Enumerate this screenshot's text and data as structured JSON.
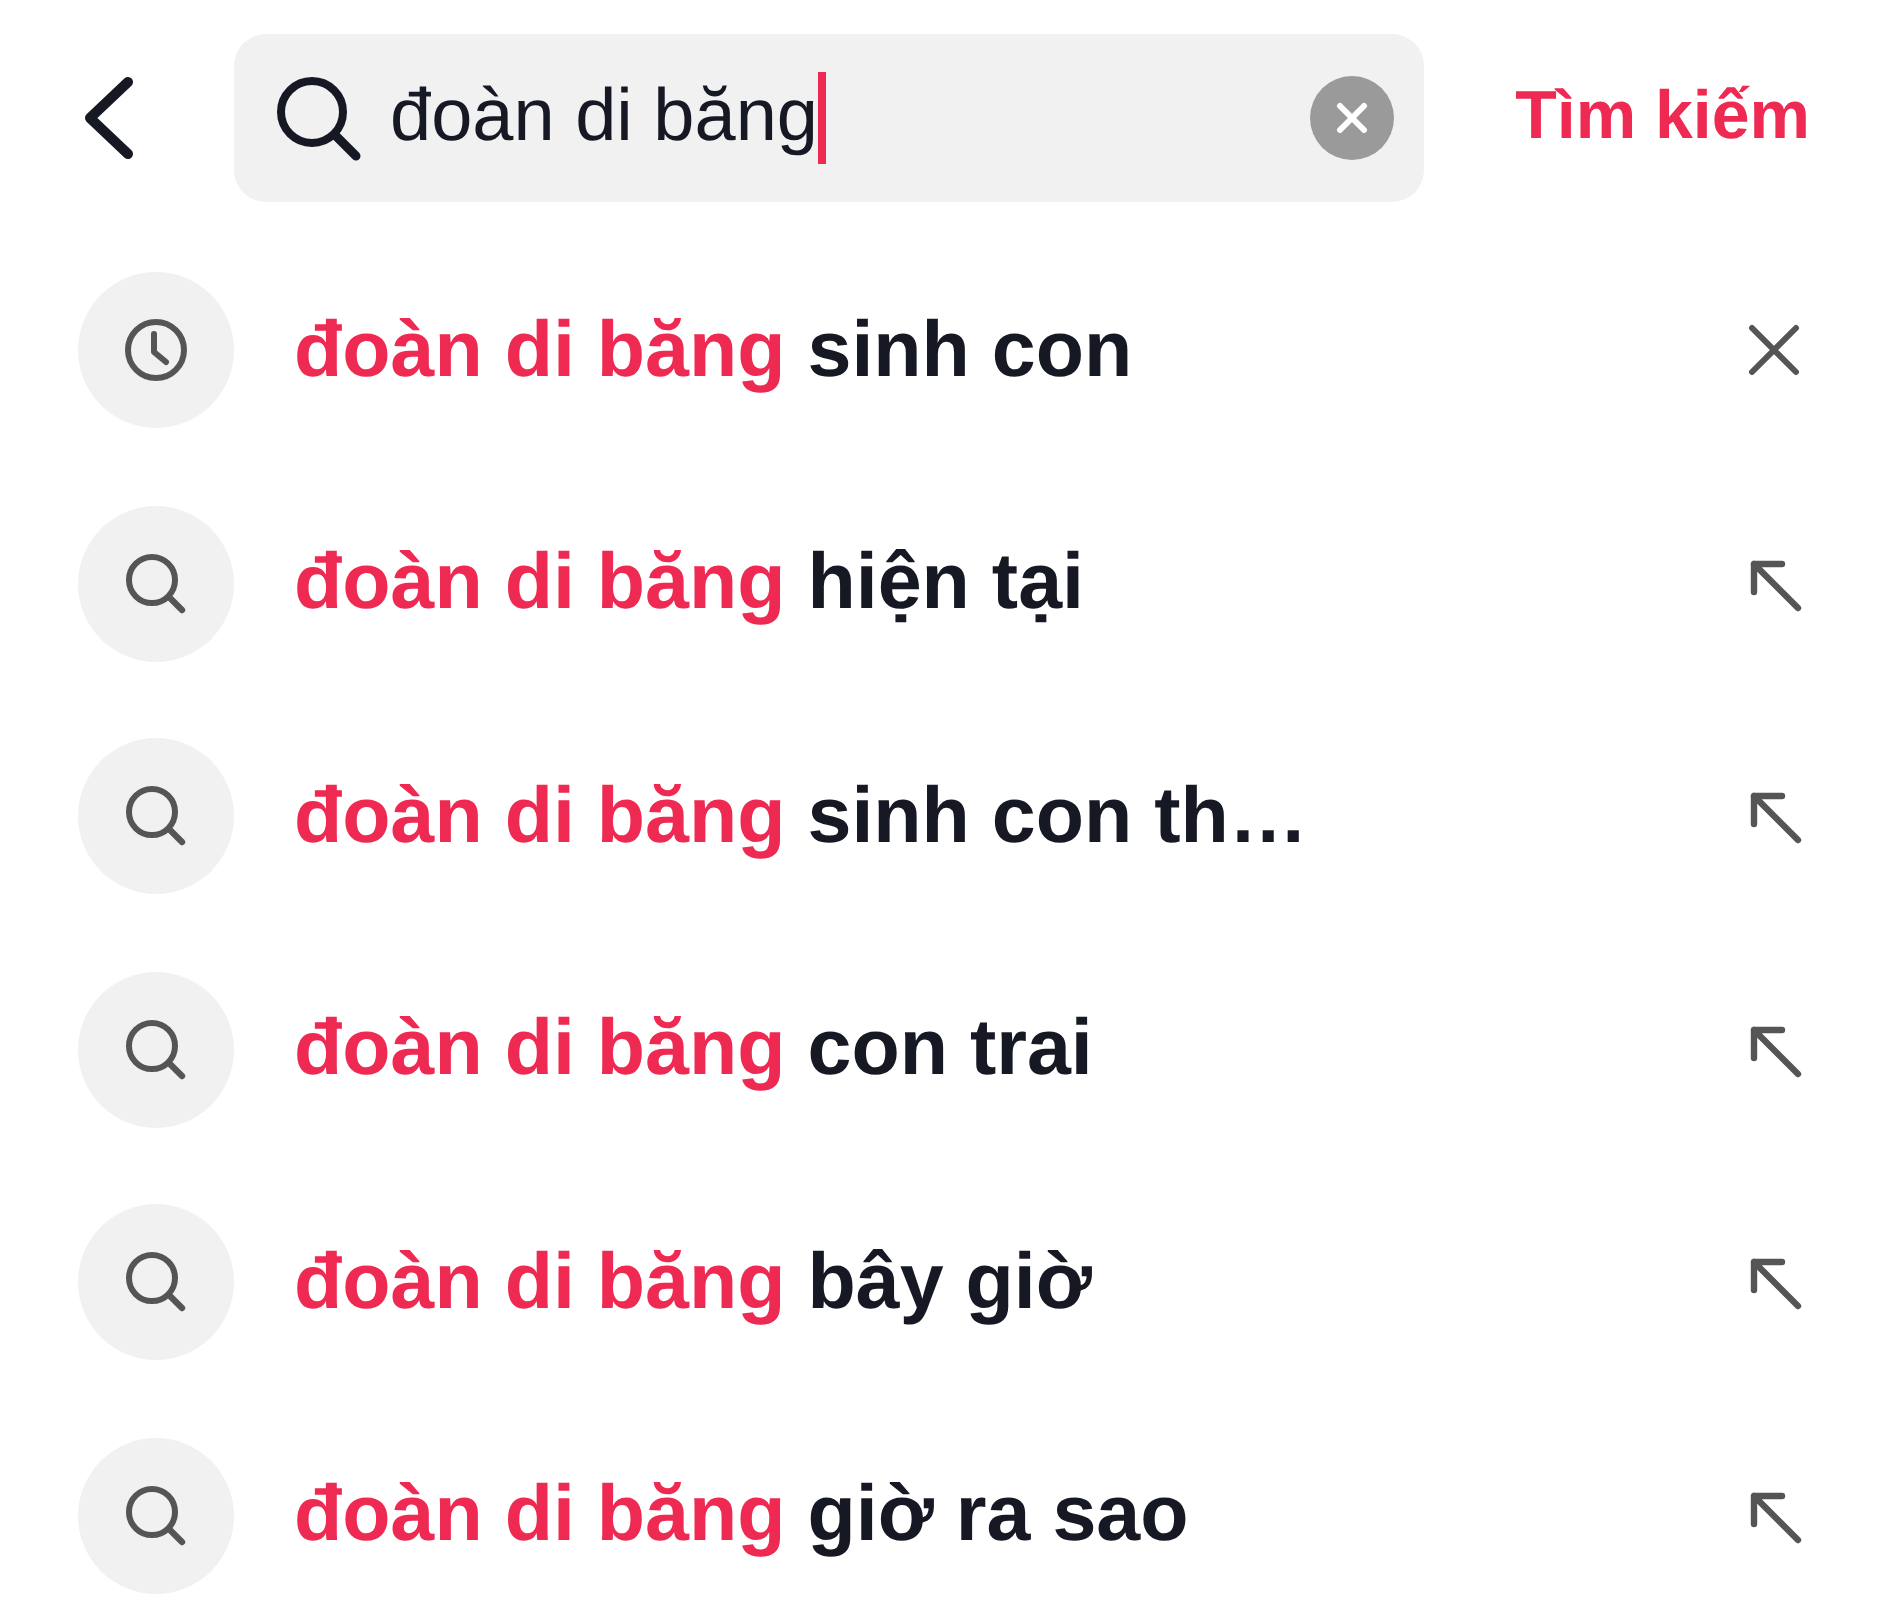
{
  "search_bar": {
    "query": "đoàn di băng",
    "submit": "Tìm kiếm"
  },
  "suggestions": [
    {
      "kind": "history",
      "match": "đoàn di băng",
      "rest": "sinh con"
    },
    {
      "kind": "suggestion",
      "match": "đoàn di băng",
      "rest": "hiện tại"
    },
    {
      "kind": "suggestion",
      "match": "đoàn di băng",
      "rest": "sinh con th…"
    },
    {
      "kind": "suggestion",
      "match": "đoàn di băng",
      "rest": "con trai"
    },
    {
      "kind": "suggestion",
      "match": "đoàn di băng",
      "rest": "bây giờ"
    },
    {
      "kind": "suggestion",
      "match": "đoàn di băng",
      "rest": "giờ ra sao"
    }
  ]
}
